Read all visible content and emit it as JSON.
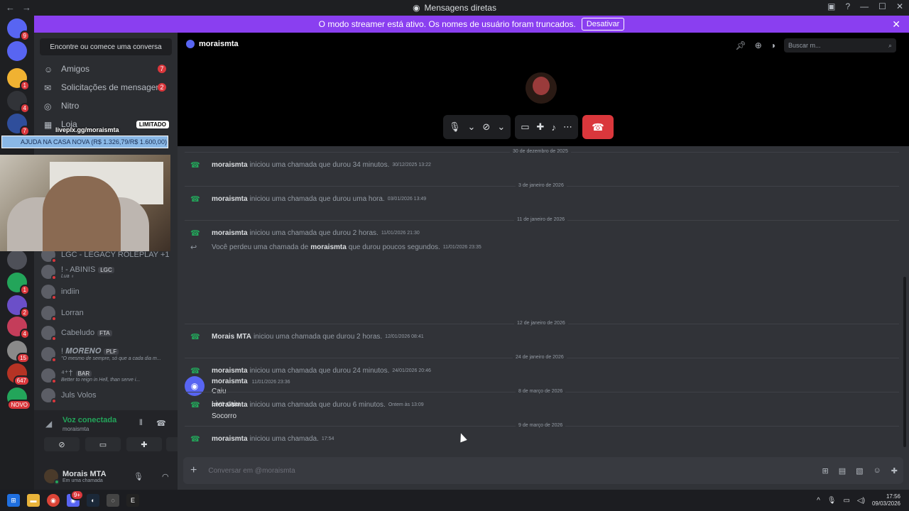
{
  "window": {
    "title": "Mensagens diretas"
  },
  "banner": {
    "text": "O modo streamer está ativo. Os nomes de usuário foram truncados.",
    "button": "Desativar"
  },
  "guilds": [
    {
      "name": "dm-home",
      "badge": "9",
      "color": "#5865f2"
    },
    {
      "name": "discord",
      "badge": "",
      "color": "#5865f2"
    },
    {
      "name": "server-1",
      "badge": "1",
      "color": "#f0b232"
    },
    {
      "name": "server-2",
      "badge": "4",
      "color": "#313338"
    },
    {
      "name": "server-3",
      "badge": "7",
      "color": "#2f4e9b"
    },
    {
      "name": "server-6",
      "badge": "",
      "color": "#4e5058"
    },
    {
      "name": "server-7",
      "badge": "1",
      "color": "#23a55a"
    },
    {
      "name": "server-8",
      "badge": "2",
      "color": "#6b4fc8"
    },
    {
      "name": "server-9",
      "badge": "4",
      "color": "#c43d5a"
    },
    {
      "name": "server-10",
      "badge": "15",
      "color": "#8a8a8a"
    },
    {
      "name": "server-11",
      "badge": "647",
      "color": "#b53324"
    },
    {
      "name": "server-12",
      "badge": "NOVO",
      "color": "#23a55a"
    }
  ],
  "sidebar": {
    "find": "Encontre ou comece uma conversa",
    "items": [
      {
        "label": "Amigos",
        "count": "7"
      },
      {
        "label": "Solicitações de mensagens",
        "count": "2"
      },
      {
        "label": "Nitro",
        "count": ""
      },
      {
        "label": "Loja",
        "badge": "LIMITADO"
      }
    ],
    "overlay_link": "livepix.gg/moraismta",
    "overlay_goal": "AJUDA NA CASA NOVA (R$ 1.326,79/R$ 1.600,00)",
    "dms": [
      {
        "name": "LGC - LEGACY ROLEPLAY +1",
        "sub": "",
        "tag": ""
      },
      {
        "name": "! - ABINIS",
        "sub": "Lua ♁",
        "tag": "LGC"
      },
      {
        "name": "indiin",
        "sub": "",
        "tag": ""
      },
      {
        "name": "Lorran",
        "sub": "",
        "tag": ""
      },
      {
        "name": "Cabeludo",
        "sub": "",
        "tag": "FTA"
      },
      {
        "name": "! 𝑴𝑶𝑹𝑬𝑵𝑶",
        "sub": "\"O mesmo de sempre, só que a cada dia m...",
        "tag": "PLF"
      },
      {
        "name": "⁴⁺†",
        "sub": "Better to reign in Hell, than serve i...",
        "tag": "BAR"
      },
      {
        "name": "Juls Volos",
        "sub": "",
        "tag": ""
      }
    ]
  },
  "voice": {
    "status": "Voz conectada",
    "channel": "moraismta"
  },
  "user": {
    "name": "Morais MTA",
    "status": "Em uma chamada"
  },
  "header": {
    "dm_name": "moraismta",
    "search_placeholder": "Buscar m..."
  },
  "chat": {
    "dividers": [
      "30 de dezembro de 2025",
      "3 de janeiro de 2026",
      "11 de janeiro de 2026",
      "12 de janeiro de 2026",
      "24 de janeiro de 2026",
      "8 de março de 2026",
      "9 de março de 2026"
    ],
    "calls": [
      {
        "user": "moraismta",
        "text": "iniciou uma chamada que durou 34 minutos.",
        "ts": "30/12/2025 13:22",
        "missed": false
      },
      {
        "user": "moraismta",
        "text": "iniciou uma chamada que durou uma hora.",
        "ts": "03/01/2026 13:49",
        "missed": false
      },
      {
        "user": "moraismta",
        "text": "iniciou uma chamada que durou 2 horas.",
        "ts": "11/01/2026 21:30",
        "missed": false
      },
      {
        "user": "",
        "text": "Você perdeu uma chamada de",
        "user2": "moraismta",
        "text2": "que durou poucos segundos.",
        "ts": "11/01/2026 23:35",
        "missed": true
      },
      {
        "user": "Morais MTA",
        "text": "iniciou uma chamada que durou 2 horas.",
        "ts": "12/01/2026 08:41",
        "missed": false
      },
      {
        "user": "moraismta",
        "text": "iniciou uma chamada que durou 24 minutos.",
        "ts": "24/01/2026 20:46",
        "missed": false
      },
      {
        "user": "moraismta",
        "text": "iniciou uma chamada que durou 6 minutos.",
        "ts": "Ontem às 13:09",
        "missed": false
      },
      {
        "user": "moraismta",
        "text": "iniciou uma chamada.",
        "ts": "17:54",
        "missed": false
      }
    ],
    "message": {
      "author": "moraismta",
      "ts": "11/01/2026 23:36",
      "lines": [
        "Caiu",
        "Live caiu",
        "Socorro"
      ]
    },
    "composer_placeholder": "Conversar em @moraismta"
  },
  "taskbar": {
    "time": "17:56",
    "date": "09/03/2026",
    "discord_badge": "9+"
  }
}
